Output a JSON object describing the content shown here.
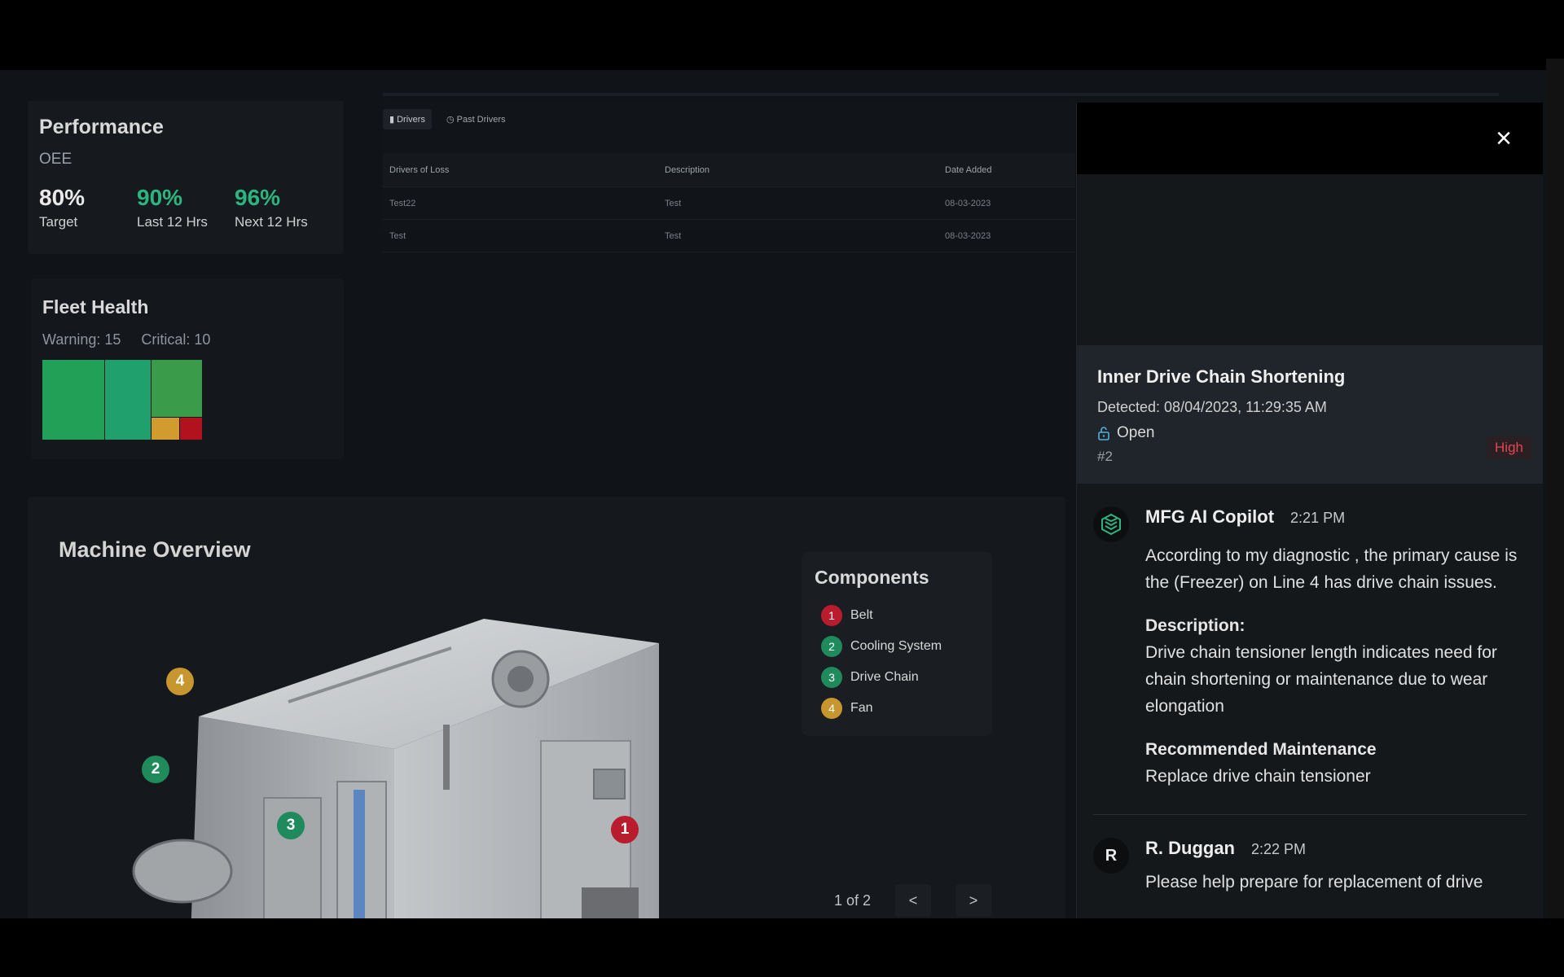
{
  "performance": {
    "title": "Performance",
    "subtitle": "OEE",
    "kpis": [
      {
        "value": "80%",
        "label": "Target"
      },
      {
        "value": "90%",
        "label": "Last 12 Hrs"
      },
      {
        "value": "96%",
        "label": "Next 12 Hrs"
      }
    ]
  },
  "fleet": {
    "title": "Fleet Health",
    "warning": "Warning: 15",
    "critical": "Critical: 10"
  },
  "drivers": {
    "tabs": [
      "Drivers",
      "Past Drivers"
    ],
    "columns": [
      "Drivers of Loss",
      "Description",
      "Date Added"
    ],
    "rows": [
      {
        "driver": "Test22",
        "description": "Test",
        "date": "08-03-2023"
      },
      {
        "driver": "Test",
        "description": "Test",
        "date": "08-03-2023"
      }
    ]
  },
  "machine": {
    "title": "Machine Overview",
    "components_title": "Components",
    "components": [
      {
        "num": "1",
        "name": "Belt"
      },
      {
        "num": "2",
        "name": "Cooling System"
      },
      {
        "num": "3",
        "name": "Drive Chain"
      },
      {
        "num": "4",
        "name": "Fan"
      }
    ],
    "markers": [
      "4",
      "2",
      "3",
      "1"
    ],
    "pager": {
      "count": "1 of 2",
      "prev": "<",
      "next": ">"
    }
  },
  "panel": {
    "close": "×",
    "issue": {
      "title": "Inner Drive Chain Shortening",
      "detected": "Detected: 08/04/2023, 11:29:35 AM",
      "status": "Open",
      "number": "#2",
      "severity": "High"
    },
    "messages": [
      {
        "author": "MFG AI Copilot",
        "time": "2:21 PM",
        "body": "According to my diagnostic , the primary cause is the (Freezer) on Line 4 has drive chain issues.",
        "description_heading": "Description:",
        "description": "Drive chain tensioner length indicates need for chain shortening or maintenance due to wear elongation",
        "maintenance_heading": "Recommended Maintenance",
        "maintenance": "Replace drive chain tensioner"
      },
      {
        "avatar": "R",
        "author": "R. Duggan",
        "time": "2:22 PM",
        "body": "Please help prepare for replacement of drive"
      }
    ]
  },
  "colors": {
    "green": "#2cb57f",
    "critical_red": "#b91c2c",
    "warning_yellow": "#c8962f",
    "severity_high": "#e0474e"
  }
}
